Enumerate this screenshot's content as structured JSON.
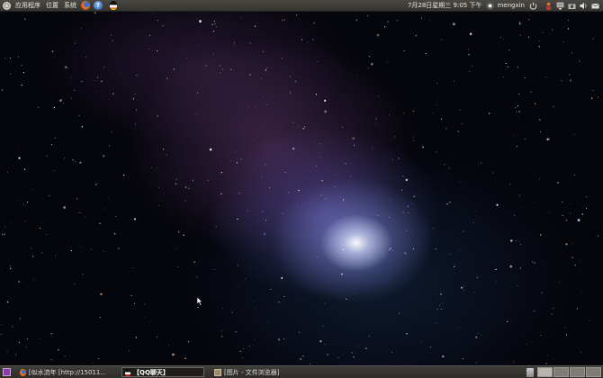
{
  "top_panel": {
    "menus": [
      "应用程序",
      "位置",
      "系统"
    ],
    "clock": "7月28日星期三  9:05 下午",
    "user": "mengxin"
  },
  "taskbar": {
    "tasks": [
      {
        "label": "[似水流年 [http://15011...",
        "active": false
      },
      {
        "label": "【QQ聊天】",
        "active": true
      },
      {
        "label": "[图片 - 文件浏览器]",
        "active": false
      }
    ]
  },
  "colors": {
    "panel": "#3d3b36",
    "accent": "#e07a2e"
  },
  "icons": [
    "ubuntu-logo-icon",
    "firefox-icon",
    "help-icon",
    "qq-penguin-icon",
    "user-switch-icon",
    "network-icon",
    "mail-icon",
    "camera-icon",
    "volume-icon",
    "envelope-icon",
    "power-icon",
    "show-desktop-icon",
    "trash-icon"
  ]
}
